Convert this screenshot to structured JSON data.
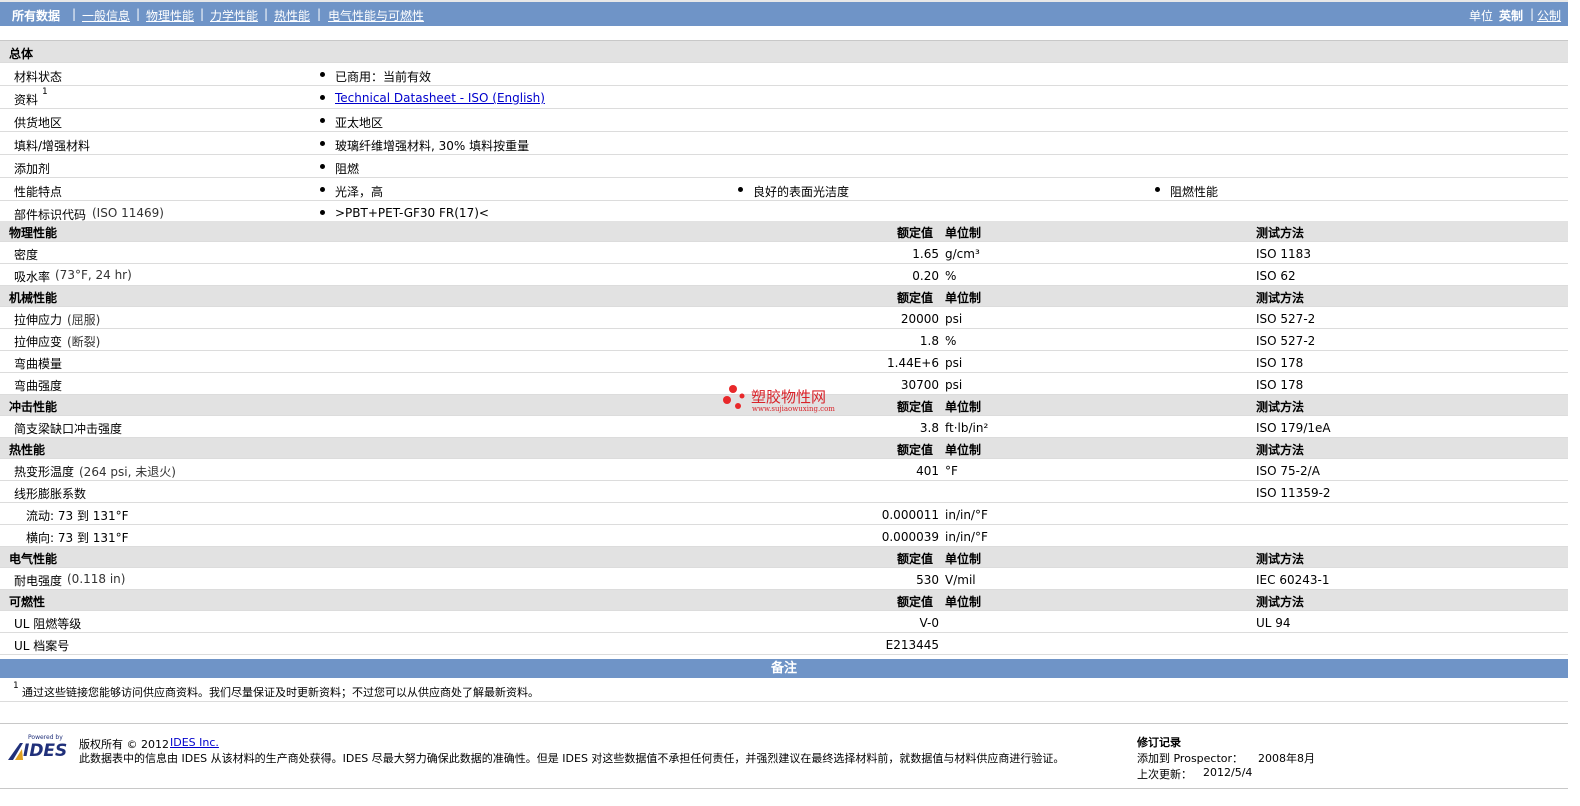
{
  "nav": {
    "items": [
      "所有数据",
      "一般信息",
      "物理性能",
      "力学性能",
      "热性能",
      "电气性能与可燃性"
    ],
    "units_label": "单位",
    "units": [
      "英制",
      "公制"
    ]
  },
  "general": {
    "title": "总体",
    "rows": [
      {
        "label": "材料状态",
        "sup": "",
        "cond": "",
        "values": [
          "已商用：当前有效"
        ]
      },
      {
        "label": "资料",
        "sup": "1",
        "cond": "",
        "link": "Technical Datasheet - ISO (English)"
      },
      {
        "label": "供货地区",
        "sup": "",
        "cond": "",
        "values": [
          "亚太地区"
        ]
      },
      {
        "label": "填料/增强材料",
        "sup": "",
        "cond": "",
        "values": [
          "玻璃纤维增强材料, 30% 填料按重量"
        ]
      },
      {
        "label": "添加剂",
        "sup": "",
        "cond": "",
        "values": [
          "阻燃"
        ]
      },
      {
        "label": "性能特点",
        "sup": "",
        "cond": "",
        "values": [
          "光泽，高",
          "良好的表面光洁度",
          "阻燃性能"
        ]
      },
      {
        "label": "部件标识代码",
        "sup": "",
        "cond": "(ISO 11469)",
        "values": [
          ">PBT+PET-GF30 FR(17)<"
        ]
      }
    ]
  },
  "col_headers": {
    "value": "额定值",
    "unit": "单位制",
    "method": "测试方法"
  },
  "sections": [
    {
      "title": "物理性能",
      "rows": [
        {
          "label": "密度",
          "cond": "",
          "value": "1.65",
          "unit": "g/cm³",
          "method": "ISO 1183"
        },
        {
          "label": "吸水率",
          "cond": "(73°F, 24 hr)",
          "value": "0.20",
          "unit": "%",
          "method": "ISO 62"
        }
      ]
    },
    {
      "title": "机械性能",
      "rows": [
        {
          "label": "拉伸应力",
          "cond": "(屈服)",
          "value": "20000",
          "unit": "psi",
          "method": "ISO 527-2"
        },
        {
          "label": "拉伸应变",
          "cond": "(断裂)",
          "value": "1.8",
          "unit": "%",
          "method": "ISO 527-2"
        },
        {
          "label": "弯曲模量",
          "cond": "",
          "value": "1.44E+6",
          "unit": "psi",
          "method": "ISO 178"
        },
        {
          "label": "弯曲强度",
          "cond": "",
          "value": "30700",
          "unit": "psi",
          "method": "ISO 178"
        }
      ]
    },
    {
      "title": "冲击性能",
      "rows": [
        {
          "label": "简支梁缺口冲击强度",
          "cond": "",
          "value": "3.8",
          "unit": "ft·lb/in²",
          "method": "ISO 179/1eA"
        }
      ]
    },
    {
      "title": "热性能",
      "rows": [
        {
          "label": "热变形温度",
          "cond": "(264 psi, 未退火)",
          "value": "401",
          "unit": "°F",
          "method": "ISO 75-2/A"
        },
        {
          "label": "线形膨胀系数",
          "cond": "",
          "value": "",
          "unit": "",
          "method": "ISO 11359-2"
        },
        {
          "label": "流动: 73 到  131°F",
          "cond": "",
          "value": "0.000011",
          "unit": "in/in/°F",
          "method": "",
          "indent": true
        },
        {
          "label": "横向: 73 到  131°F",
          "cond": "",
          "value": "0.000039",
          "unit": "in/in/°F",
          "method": "",
          "indent": true
        }
      ]
    },
    {
      "title": "电气性能",
      "rows": [
        {
          "label": "耐电强度",
          "cond": "(0.118 in)",
          "value": "530",
          "unit": "V/mil",
          "method": "IEC 60243-1"
        }
      ]
    },
    {
      "title": "可燃性",
      "rows": [
        {
          "label": "UL 阻燃等级",
          "cond": "",
          "value": "V-0",
          "unit": "",
          "method": "UL 94"
        },
        {
          "label": "UL 档案号",
          "cond": "",
          "value": "E213445",
          "unit": "",
          "method": "",
          "nohdrcols": true
        }
      ]
    }
  ],
  "watermark": {
    "title": "塑胶物性网",
    "url": "www.sujiaowuxing.com"
  },
  "notes": {
    "title": "备注",
    "sup": "1",
    "text": "通过这些链接您能够访问供应商资料。我们尽量保证及时更新资料；不过您可以从供应商处了解最新资料。"
  },
  "footer": {
    "logo_small": "Powered by",
    "logo": "IDES",
    "copyright": "版权所有  © 2012",
    "company": "IDES Inc.",
    "disclaimer": "此数据表中的信息由  IDES 从该材料的生产商处获得。IDES 尽最大努力确保此数据的准确性。但是  IDES 对这些数据值不承担任何责任，并强烈建议在最终选择材料前，就数据值与材料供应商进行验证。",
    "revision_title": "修订记录",
    "added_label": "添加到 Prospector：",
    "added_value": "2008年8月",
    "updated_label": "上次更新：",
    "updated_value": "2012/5/4"
  }
}
